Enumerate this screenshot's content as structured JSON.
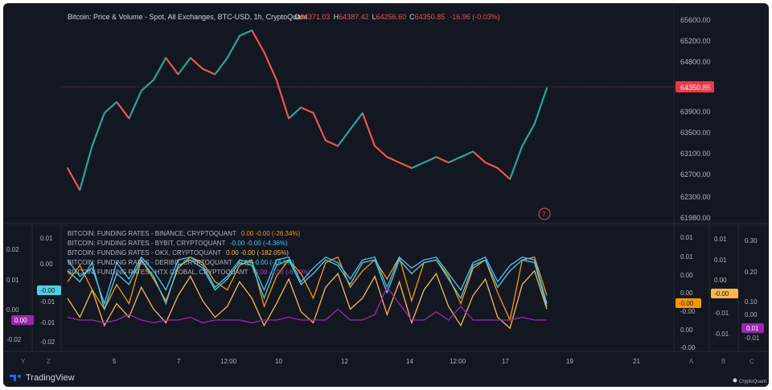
{
  "header": {
    "symbol": "Bitcoin: Price & Volume - Spot, All Exchanges, BTC-USD, 1h, CryptoQuant",
    "o_label": "O",
    "o_value": "64371.03",
    "h_label": "H",
    "h_value": "64387.42",
    "l_label": "L",
    "l_value": "64256.60",
    "c_label": "C",
    "c_value": "64350.85",
    "change": "-16.96 (-0.03%)"
  },
  "price_axis": {
    "ticks": [
      "65600.00",
      "65200.00",
      "64800.00",
      "63900.00",
      "63500.00",
      "63100.00",
      "62700.00",
      "62300.00",
      "61980.00"
    ],
    "last_price": "64350.85"
  },
  "funding_legend": [
    {
      "text": "BITCOIN: FUNDING RATES - BINANCE, CRYPTOQUANT",
      "value": "0.00  -0.00 (-26.34%)",
      "color": "#f7a600"
    },
    {
      "text": "BITCOIN: FUNDING RATES - BYBIT, CRYPTOQUANT",
      "value": "-0.00  -0.00 (-4.36%)",
      "color": "#5b9cf6"
    },
    {
      "text": "BITCOIN: FUNDING RATES - OKX, CRYPTOQUANT",
      "value": "0.00  -0.00 (-182.05%)",
      "color": "#f7a600"
    },
    {
      "text": "BITCOIN: FUNDING RATES - DERIBIT, CRYPTOQUANT",
      "value": "-0.00  -0.00 (-18.1%)",
      "color": "#4dd0e1"
    },
    {
      "text": "BITCOIN: FUNDING RATES - HTX GLOBAL, CRYPTOQUANT",
      "value": "-0.00  -0.00 (-6.40%)",
      "color": "#ab47bc"
    }
  ],
  "left_axis_a": [
    "0.02",
    "0.01",
    "0.00",
    "-0.00",
    "-0.02"
  ],
  "left_axis_b": [
    "0.01",
    "0.00",
    "-0.01",
    "-0.01",
    "-0.02"
  ],
  "left_badge_a": "0.00",
  "left_badge_b": "-0.00",
  "right_axis_a": [
    "0.01",
    "0.01",
    "0.00",
    "0.00",
    "-0.00",
    "0.00",
    "-0.00"
  ],
  "right_axis_b": [
    "0.01",
    "0.01",
    "0.00",
    "-0.01",
    "-0.01"
  ],
  "right_axis_c": [
    "0.30",
    "0.20",
    "0.10",
    "0.00",
    "-0.01"
  ],
  "badge_a": "-0.00",
  "badge_b": "-0.00",
  "badge_c": "0.01",
  "x_ticks": [
    "5",
    "7",
    "12:00",
    "10",
    "12",
    "14",
    "12:00",
    "17",
    "19",
    "21"
  ],
  "bottom_labels": {
    "y": "Y",
    "z": "Z",
    "a": "A",
    "b": "B",
    "c": "C"
  },
  "marker": "7",
  "brand": {
    "name": "TradingView",
    "source": "CryptoQuant"
  },
  "colors": {
    "bg": "#131722",
    "up": "#26a69a",
    "down": "#ef5350",
    "orange": "#ff9800",
    "sky": "#4fc3f7",
    "yellow": "#ffb74d",
    "purple": "#9c27b0",
    "badge_red": "#f23645",
    "badge_cyan": "#4dd0e1",
    "badge_purple": "#9c27b0",
    "badge_orange": "#ffb74d"
  },
  "chart_data": [
    {
      "type": "line",
      "title": "Bitcoin: Price & Volume - Spot, All Exchanges, BTC-USD, 1h, CryptoQuant",
      "x_ticks": [
        "5",
        "7",
        "12:00",
        "10",
        "12",
        "14",
        "12:00",
        "17",
        "19",
        "21"
      ],
      "ylim": [
        61980,
        65600
      ],
      "series": [
        {
          "name": "BTC-USD",
          "values": [
            62900,
            62500,
            63300,
            63900,
            64100,
            63800,
            64300,
            64500,
            64900,
            64600,
            64900,
            64700,
            64600,
            64900,
            65300,
            65400,
            65000,
            64500,
            63800,
            64000,
            63900,
            63400,
            63300,
            63600,
            63900,
            63300,
            63100,
            63000,
            62900,
            63000,
            63100,
            63000,
            63100,
            63200,
            63000,
            62900,
            62700,
            63300,
            63700,
            64350
          ]
        }
      ]
    },
    {
      "type": "line",
      "title": "Funding Rates",
      "ylim": [
        -0.02,
        0.02
      ],
      "series": [
        {
          "name": "BITCOIN: FUNDING RATES - BINANCE, CRYPTOQUANT",
          "values": [
            0.004,
            0.01,
            0.001,
            -0.006,
            0.003,
            -0.004,
            0.012,
            0.005,
            -0.003,
            0.009,
            0.013,
            0.011,
            0.004,
            0.001,
            0.01,
            0.012,
            -0.005,
            0.006,
            0.012,
            0.007,
            -0.002,
            0.011,
            0.013,
            0.002,
            0.008,
            0.012,
            0.005,
            0.013,
            -0.003,
            0.011,
            0.012,
            0.006,
            -0.004,
            0.009,
            0.012,
            0.0,
            -0.01,
            0.012,
            0.013,
            -0.001
          ]
        },
        {
          "name": "BITCOIN: FUNDING RATES - BYBIT, CRYPTOQUANT",
          "values": [
            0.012,
            0.006,
            0.009,
            -0.004,
            0.011,
            0.005,
            0.013,
            0.008,
            0.001,
            0.012,
            0.013,
            0.01,
            0.002,
            0.006,
            0.012,
            0.011,
            0.001,
            0.012,
            0.013,
            0.004,
            0.009,
            0.013,
            0.011,
            0.005,
            0.012,
            0.013,
            0.002,
            0.013,
            0.009,
            0.012,
            0.013,
            0.007,
            0.001,
            0.011,
            0.013,
            0.004,
            0.01,
            0.013,
            0.012,
            -0.004
          ]
        },
        {
          "name": "BITCOIN: FUNDING RATES - OKX, CRYPTOQUANT",
          "values": [
            -0.002,
            -0.009,
            0.001,
            -0.012,
            -0.004,
            -0.009,
            0.002,
            -0.006,
            -0.011,
            -0.001,
            0.006,
            -0.003,
            -0.009,
            -0.005,
            0.004,
            -0.002,
            -0.012,
            -0.004,
            0.005,
            -0.007,
            -0.011,
            0.002,
            0.007,
            -0.006,
            -0.002,
            0.006,
            -0.008,
            0.004,
            -0.011,
            0.001,
            0.007,
            -0.005,
            -0.012,
            -0.001,
            0.005,
            -0.009,
            -0.013,
            0.003,
            0.008,
            -0.006
          ]
        },
        {
          "name": "BITCOIN: FUNDING RATES - DERIBIT, CRYPTOQUANT",
          "values": [
            0.008,
            0.004,
            0.011,
            -0.006,
            0.007,
            0.003,
            0.012,
            0.006,
            -0.004,
            0.01,
            0.012,
            0.009,
            0.001,
            0.005,
            0.011,
            0.01,
            -0.002,
            0.01,
            0.012,
            0.003,
            0.007,
            0.012,
            0.01,
            0.003,
            0.011,
            0.012,
            0.0,
            0.012,
            0.007,
            0.011,
            0.012,
            0.005,
            -0.002,
            0.01,
            0.012,
            0.002,
            0.008,
            0.012,
            0.011,
            -0.005
          ]
        },
        {
          "name": "BITCOIN: FUNDING RATES - HTX GLOBAL, CRYPTOQUANT",
          "values": [
            -0.009,
            -0.01,
            -0.01,
            -0.011,
            -0.01,
            -0.008,
            -0.01,
            -0.011,
            -0.01,
            -0.01,
            -0.009,
            -0.011,
            -0.01,
            -0.01,
            -0.01,
            -0.011,
            -0.01,
            -0.01,
            -0.009,
            -0.01,
            -0.01,
            -0.01,
            -0.006,
            -0.01,
            -0.01,
            -0.008,
            0.002,
            -0.004,
            -0.01,
            -0.01,
            -0.007,
            -0.01,
            -0.005,
            -0.01,
            -0.01,
            -0.01,
            -0.01,
            -0.009,
            -0.01,
            -0.01
          ]
        }
      ]
    }
  ]
}
